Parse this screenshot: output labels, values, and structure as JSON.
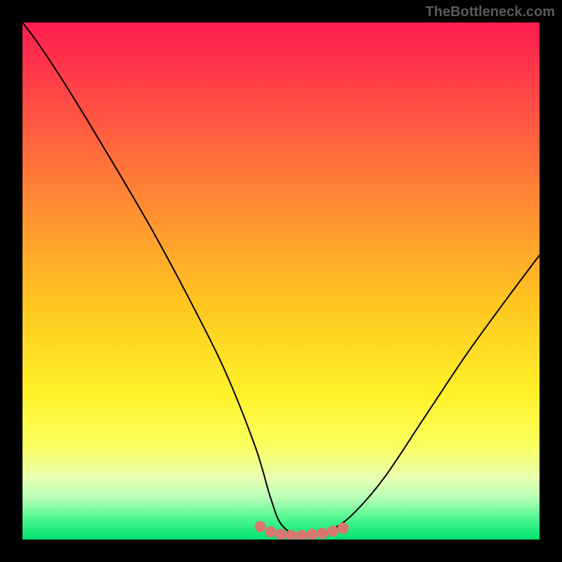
{
  "watermark": "TheBottleneck.com",
  "chart_data": {
    "type": "line",
    "title": "",
    "xlabel": "",
    "ylabel": "",
    "xlim": [
      0,
      100
    ],
    "ylim": [
      0,
      100
    ],
    "background_gradient": {
      "direction": "vertical",
      "stops": [
        {
          "pos": 0.0,
          "color": "#ff1e50"
        },
        {
          "pos": 0.25,
          "color": "#ff6a3c"
        },
        {
          "pos": 0.55,
          "color": "#ffc820"
        },
        {
          "pos": 0.82,
          "color": "#faff60"
        },
        {
          "pos": 0.92,
          "color": "#b7ffb7"
        },
        {
          "pos": 1.0,
          "color": "#00e36e"
        }
      ]
    },
    "series": [
      {
        "name": "bottleneck-curve",
        "color": "#000000",
        "stroke_width": 2,
        "x": [
          0,
          3,
          7,
          12,
          18,
          25,
          32,
          39,
          45,
          48,
          50,
          53,
          57,
          60,
          64,
          70,
          78,
          86,
          94,
          100
        ],
        "y": [
          100,
          96,
          90,
          82,
          72,
          60,
          47,
          33,
          18,
          8,
          3,
          1,
          1,
          2,
          5,
          12,
          24,
          36,
          47,
          55
        ]
      },
      {
        "name": "highlight-dots",
        "color": "#d7776f",
        "type": "scatter",
        "marker_radius": 8,
        "x": [
          46,
          48,
          50,
          52,
          54,
          56,
          58,
          60,
          62
        ],
        "y": [
          2.5,
          1.5,
          1.0,
          0.8,
          0.8,
          1.0,
          1.2,
          1.6,
          2.2
        ]
      }
    ]
  }
}
